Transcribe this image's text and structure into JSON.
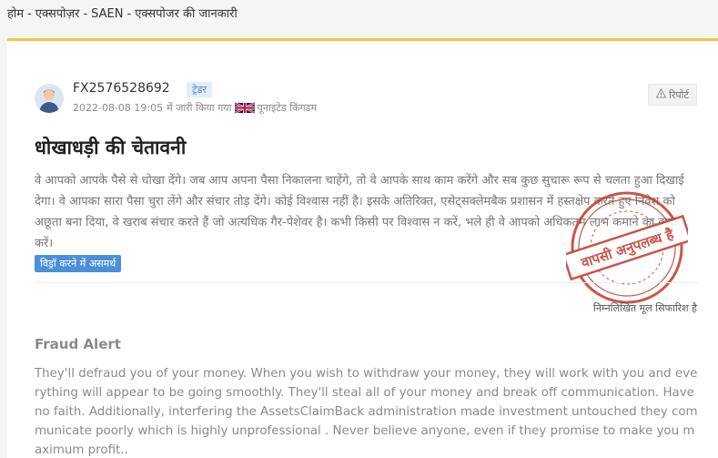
{
  "breadcrumb": {
    "home": "होम",
    "exposure": "एक्सपोज़र",
    "broker": "SAEN",
    "current": "एक्सपोजर की जानकारी",
    "separator": "-"
  },
  "post": {
    "user_id": "FX2576528692",
    "role": "ट्रेडर",
    "datetime": "2022-08-08 19:05",
    "issued_in": "में जारी किया गया",
    "country": "यूनाइटेड किंगडम",
    "report_label": "रिपोर्ट",
    "title": "धोखाधड़ी की चेतावनी",
    "body": "वे आपको आपके पैसे से धोखा देंगे। जब आप अपना पैसा निकालना चाहेंगे, तो वे आपके साथ काम करेंगे और सब कुछ सुचारू रूप से चलता हुआ दिखाई देगा। वे आपका सारा पैसा चुरा लेंगे और संचार तोड़ देंगे। कोई विश्वास नहीं है। इसके अतिरिक्त, एसेट्सक्लेमबैक प्रशासन में हस्तक्षेप करते हुए निवेश को अछूता बना दिया, वे खराब संचार करते हैं जो अत्यधिक गैर-पेशेवर है। कभी किसी पर विश्वास न करें, भले ही वे आपको अधिकतम लाभ कमाने का वादा करें।",
    "tag": "विड्रॉ करने में असमर्थ",
    "stamp_text": "वापसी अनुपलब्ध है",
    "original_note": "निम्नलिखित मूल सिफारिश है"
  },
  "original": {
    "title": "Fraud Alert",
    "body": "They'll defraud you of your money. When you wish to withdraw your money, they will work with you and everything will appear to be going smoothly. They'll steal all of your money and break off communication. Have no faith. Additionally, interfering the AssetsClaimBack administration made investment untouched they communicate poorly which is highly unprofessional . Never believe anyone, even if they promise to make you maximum profit.."
  },
  "colors": {
    "accent": "#f5c440",
    "badge": "#4a90d9",
    "stamp": "#c0392b"
  },
  "icons": {
    "avatar": "user-avatar-icon",
    "flag": "uk-flag-icon",
    "report": "warning-icon"
  }
}
